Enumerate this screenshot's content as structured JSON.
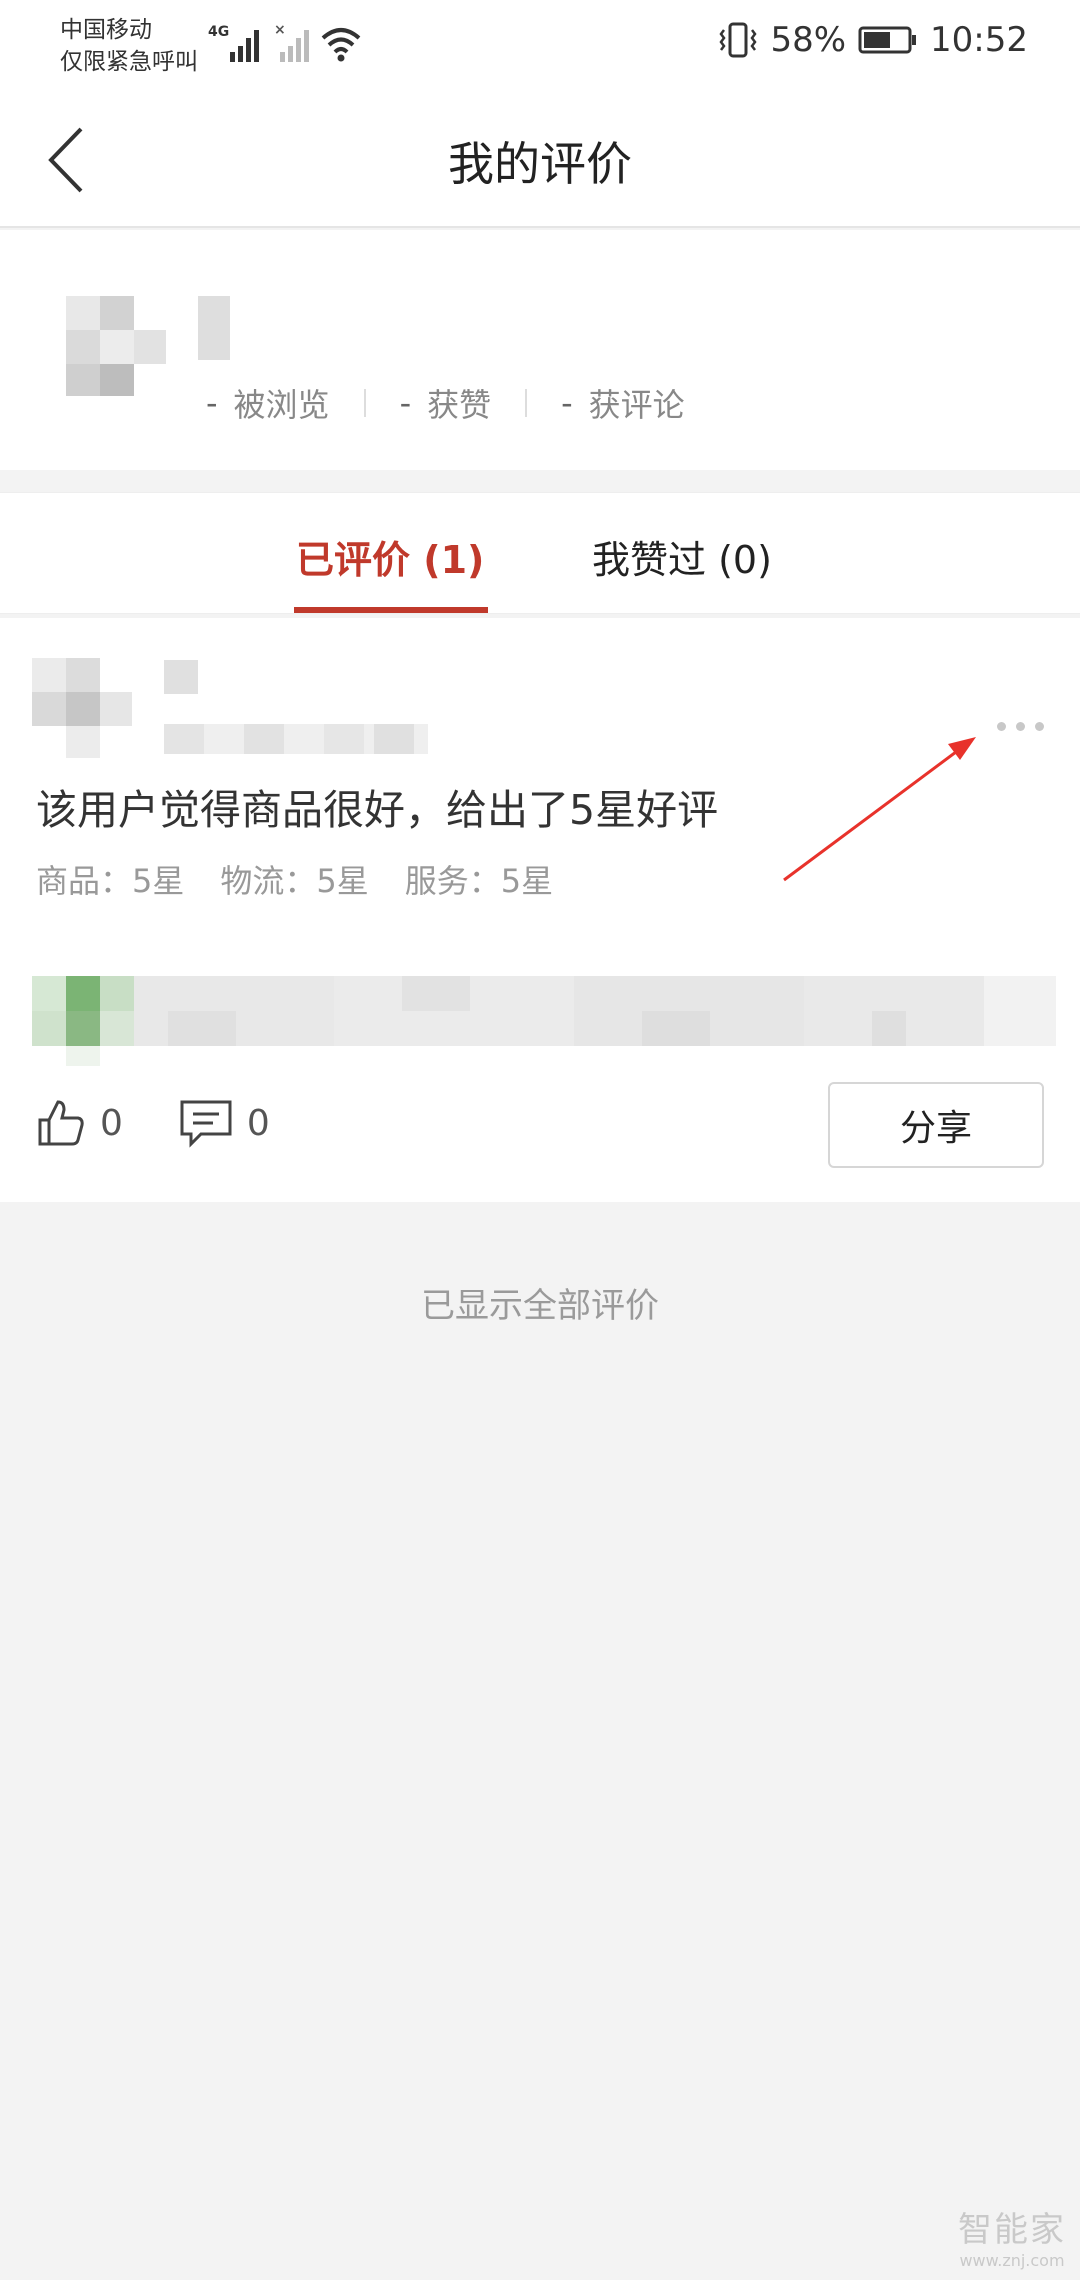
{
  "status": {
    "carrier_line1": "中国移动",
    "carrier_line2": "仅限紧急呼叫",
    "network": "4G",
    "battery": "58%",
    "time": "10:52"
  },
  "nav": {
    "title": "我的评价"
  },
  "profile": {
    "stats": [
      {
        "num": "-",
        "label": "被浏览"
      },
      {
        "num": "-",
        "label": "获赞"
      },
      {
        "num": "-",
        "label": "获评论"
      }
    ]
  },
  "tabs": [
    {
      "label": "已评价",
      "count": "(1)"
    },
    {
      "label": "我赞过",
      "count": "(0)"
    }
  ],
  "review": {
    "text": "该用户觉得商品很好，给出了5星好评",
    "ratings": [
      "商品：5星",
      "物流：5星",
      "服务：5星"
    ],
    "likes": "0",
    "comments": "0",
    "share_label": "分享"
  },
  "footer": "已显示全部评价",
  "watermark": {
    "main": "智能家",
    "sub": "www.znj.com"
  },
  "colors": {
    "accent": "#c0392b",
    "arrow": "#e8322b"
  }
}
